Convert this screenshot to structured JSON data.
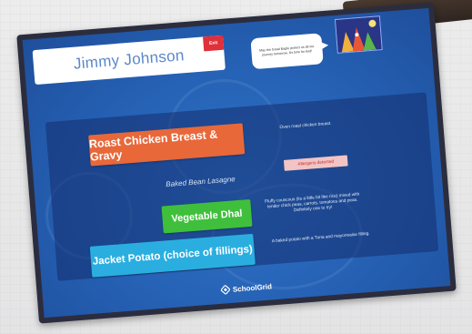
{
  "user": {
    "name": "Jimmy Johnson",
    "exit_label": "Exit"
  },
  "speech_bubble": {
    "text": "May the Great Eagle protect us all our journey tomorrow. It's time for bed!"
  },
  "menu": {
    "items": [
      {
        "name": "Roast Chicken Breast & Gravy",
        "description": "Oven roast chicken breast.",
        "color": "#e8683a",
        "selectable": true
      },
      {
        "name": "Baked Bean Lasagne",
        "allergen_label": "Allergens detected",
        "selectable": false
      },
      {
        "name": "Vegetable Dhal",
        "description": "Fluffy couscous (its a little bit like rice) mixed with tender chick peas, carrots, tomatoes and peas. Definitely one to try!",
        "color": "#3fbf3c",
        "selectable": true
      },
      {
        "name": "Jacket Potato (choice of fillings)",
        "description": "A baked potato with a Tuna and mayonnaise filling.",
        "color": "#2aaee0",
        "selectable": true
      }
    ]
  },
  "brand": {
    "name": "SchoolGrid",
    "icon": "schoolgrid-logo-icon"
  },
  "colors": {
    "screen_background": "#2560b3",
    "exit_button": "#e0303a",
    "allergen_background": "#f2c4c4",
    "allergen_text": "#c32a2a"
  }
}
